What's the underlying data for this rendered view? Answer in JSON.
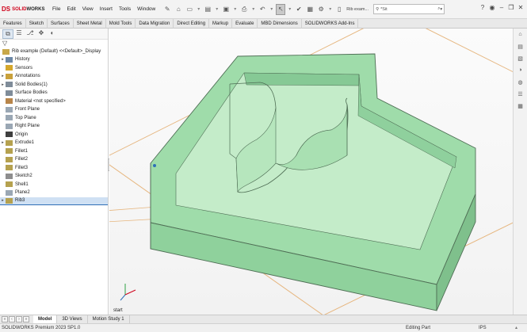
{
  "app": {
    "brand_ds": "DS",
    "brand_solid": "SOLID",
    "brand_works": "WORKS",
    "menu": [
      "File",
      "Edit",
      "View",
      "Insert",
      "Tools",
      "Window"
    ],
    "active_file_tab": "Rib exam...",
    "search_placeholder": "*Sit"
  },
  "command_tabs": [
    "Features",
    "Sketch",
    "Surfaces",
    "Sheet Metal",
    "Mold Tools",
    "Data Migration",
    "Direct Editing",
    "Markup",
    "Evaluate",
    "MBD Dimensions",
    "SOLIDWORKS Add-Ins"
  ],
  "tree": {
    "root": "Rib example (Default) <<Default>_Display",
    "items": [
      {
        "label": "History",
        "expander": "▸",
        "color": "#6b87a6"
      },
      {
        "label": "Sensors",
        "expander": "",
        "color": "#d4a72c"
      },
      {
        "label": "Annotations",
        "expander": "▸",
        "color": "#c9a13b"
      },
      {
        "label": "Solid Bodies(1)",
        "expander": "▸",
        "color": "#7f8c99"
      },
      {
        "label": "Surface Bodies",
        "expander": "",
        "color": "#7f8c99"
      },
      {
        "label": "Material <not specified>",
        "expander": "",
        "color": "#b8854a"
      },
      {
        "label": "Front Plane",
        "expander": "",
        "color": "#9aa7b4"
      },
      {
        "label": "Top Plane",
        "expander": "",
        "color": "#9aa7b4"
      },
      {
        "label": "Right Plane",
        "expander": "",
        "color": "#9aa7b4"
      },
      {
        "label": "Origin",
        "expander": "",
        "color": "#3f3f3f"
      },
      {
        "label": "Extrude1",
        "expander": "▸",
        "color": "#b5a14f"
      },
      {
        "label": "Fillet1",
        "expander": "",
        "color": "#b5a14f"
      },
      {
        "label": "Fillet2",
        "expander": "",
        "color": "#b5a14f"
      },
      {
        "label": "Fillet3",
        "expander": "",
        "color": "#b5a14f"
      },
      {
        "label": "Sketch2",
        "expander": "",
        "color": "#8e8e8e"
      },
      {
        "label": "Shell1",
        "expander": "",
        "color": "#b5a14f"
      },
      {
        "label": "Plane2",
        "expander": "",
        "color": "#9aa7b4"
      },
      {
        "label": "Rib3",
        "expander": "▸",
        "color": "#b5a14f"
      }
    ],
    "selected": "Rib3"
  },
  "viewport": {
    "model_color": "#a8e2b0",
    "accent": "#2e6fb7",
    "corner_label": "start"
  },
  "bottom_tabs": [
    "Model",
    "3D Views",
    "Motion Study 1"
  ],
  "active_bottom_tab": "Model",
  "status": {
    "left": "SOLIDWORKS Premium 2023 SP1.0",
    "mode": "Editing Part",
    "units": "IPS"
  }
}
